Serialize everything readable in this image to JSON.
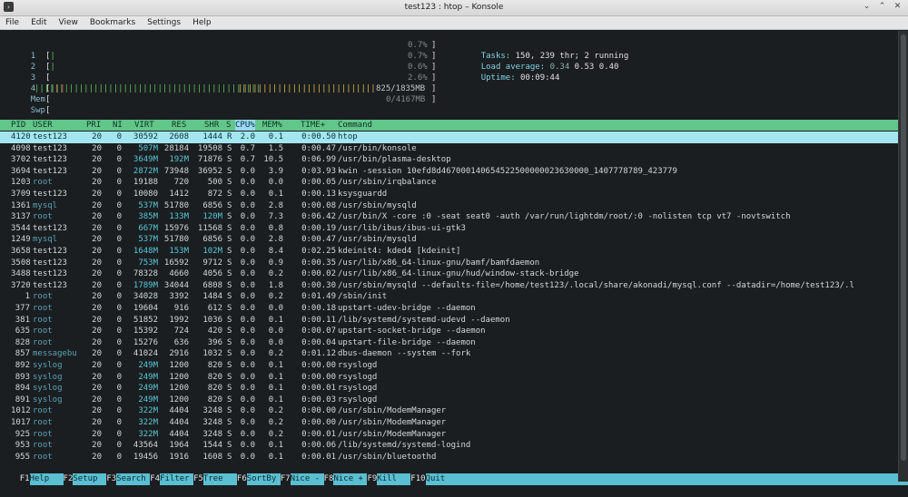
{
  "window": {
    "title": "test123 : htop – Konsole"
  },
  "menu": [
    "File",
    "Edit",
    "View",
    "Bookmarks",
    "Settings",
    "Help"
  ],
  "meters": {
    "cpus": [
      {
        "label": "1",
        "pct": "0.7%"
      },
      {
        "label": "2",
        "pct": "0.7%"
      },
      {
        "label": "3",
        "pct": "0.6%"
      },
      {
        "label": "4",
        "pct": "2.6%"
      }
    ],
    "mem": {
      "label": "Mem",
      "value": "825/1835MB"
    },
    "swp": {
      "label": "Swp",
      "value": "0/4167MB"
    }
  },
  "summary": {
    "tasks_label": "Tasks:",
    "tasks_value": "150, 239 thr; 2 running",
    "load_label": "Load average:",
    "load_1": "0.34",
    "load_5": "0.53",
    "load_15": "0.40",
    "uptime_label": "Uptime:",
    "uptime_value": "00:09:44"
  },
  "columns": [
    "PID",
    "USER",
    "PRI",
    "NI",
    "VIRT",
    "RES",
    "SHR",
    "S",
    "CPU%",
    "MEM%",
    "TIME+",
    "Command"
  ],
  "processes": [
    {
      "pid": "4120",
      "user": "test123",
      "pri": "20",
      "ni": "0",
      "virt": "30592",
      "res": "2608",
      "shr": "1444",
      "s": "R",
      "cpu": "2.0",
      "mem": "0.1",
      "time": "0:00.50",
      "cmd": "htop"
    },
    {
      "pid": "4098",
      "user": "test123",
      "pri": "20",
      "ni": "0",
      "virt": "507M",
      "res": "28184",
      "shr": "19508",
      "s": "S",
      "cpu": "0.7",
      "mem": "1.5",
      "time": "0:00.47",
      "cmd": "/usr/bin/konsole"
    },
    {
      "pid": "3702",
      "user": "test123",
      "pri": "20",
      "ni": "0",
      "virt": "3649M",
      "res": "192M",
      "shr": "71876",
      "s": "S",
      "cpu": "0.7",
      "mem": "10.5",
      "time": "0:06.99",
      "cmd": "/usr/bin/plasma-desktop"
    },
    {
      "pid": "3694",
      "user": "test123",
      "pri": "20",
      "ni": "0",
      "virt": "2872M",
      "res": "73948",
      "shr": "36952",
      "s": "S",
      "cpu": "0.0",
      "mem": "3.9",
      "time": "0:03.93",
      "cmd": "kwin -session 10efd8d467000140654522500000023630000_1407778789_423779"
    },
    {
      "pid": "1203",
      "user": "root",
      "pri": "20",
      "ni": "0",
      "virt": "19188",
      "res": "720",
      "shr": "500",
      "s": "S",
      "cpu": "0.0",
      "mem": "0.0",
      "time": "0:00.05",
      "cmd": "/usr/sbin/irqbalance"
    },
    {
      "pid": "3709",
      "user": "test123",
      "pri": "20",
      "ni": "0",
      "virt": "10080",
      "res": "1412",
      "shr": "872",
      "s": "S",
      "cpu": "0.0",
      "mem": "0.1",
      "time": "0:00.13",
      "cmd": "ksysguardd"
    },
    {
      "pid": "1361",
      "user": "mysql",
      "pri": "20",
      "ni": "0",
      "virt": "537M",
      "res": "51780",
      "shr": "6856",
      "s": "S",
      "cpu": "0.0",
      "mem": "2.8",
      "time": "0:00.08",
      "cmd": "/usr/sbin/mysqld"
    },
    {
      "pid": "3137",
      "user": "root",
      "pri": "20",
      "ni": "0",
      "virt": "385M",
      "res": "133M",
      "shr": "120M",
      "s": "S",
      "cpu": "0.0",
      "mem": "7.3",
      "time": "0:06.42",
      "cmd": "/usr/bin/X -core :0 -seat seat0 -auth /var/run/lightdm/root/:0 -nolisten tcp vt7 -novtswitch"
    },
    {
      "pid": "3544",
      "user": "test123",
      "pri": "20",
      "ni": "0",
      "virt": "667M",
      "res": "15976",
      "shr": "11568",
      "s": "S",
      "cpu": "0.0",
      "mem": "0.8",
      "time": "0:00.19",
      "cmd": "/usr/lib/ibus/ibus-ui-gtk3"
    },
    {
      "pid": "1249",
      "user": "mysql",
      "pri": "20",
      "ni": "0",
      "virt": "537M",
      "res": "51780",
      "shr": "6856",
      "s": "S",
      "cpu": "0.0",
      "mem": "2.8",
      "time": "0:00.47",
      "cmd": "/usr/sbin/mysqld"
    },
    {
      "pid": "3658",
      "user": "test123",
      "pri": "20",
      "ni": "0",
      "virt": "1648M",
      "res": "153M",
      "shr": "102M",
      "s": "S",
      "cpu": "0.0",
      "mem": "8.4",
      "time": "0:02.25",
      "cmd": "kdeinit4: kded4 [kdeinit]"
    },
    {
      "pid": "3508",
      "user": "test123",
      "pri": "20",
      "ni": "0",
      "virt": "753M",
      "res": "16592",
      "shr": "9712",
      "s": "S",
      "cpu": "0.0",
      "mem": "0.9",
      "time": "0:00.35",
      "cmd": "/usr/lib/x86_64-linux-gnu/bamf/bamfdaemon"
    },
    {
      "pid": "3488",
      "user": "test123",
      "pri": "20",
      "ni": "0",
      "virt": "78328",
      "res": "4660",
      "shr": "4056",
      "s": "S",
      "cpu": "0.0",
      "mem": "0.2",
      "time": "0:00.02",
      "cmd": "/usr/lib/x86_64-linux-gnu/hud/window-stack-bridge"
    },
    {
      "pid": "3720",
      "user": "test123",
      "pri": "20",
      "ni": "0",
      "virt": "1789M",
      "res": "34044",
      "shr": "6808",
      "s": "S",
      "cpu": "0.0",
      "mem": "1.8",
      "time": "0:00.30",
      "cmd": "/usr/sbin/mysqld --defaults-file=/home/test123/.local/share/akonadi/mysql.conf --datadir=/home/test123/.l"
    },
    {
      "pid": "1",
      "user": "root",
      "pri": "20",
      "ni": "0",
      "virt": "34028",
      "res": "3392",
      "shr": "1484",
      "s": "S",
      "cpu": "0.0",
      "mem": "0.2",
      "time": "0:01.49",
      "cmd": "/sbin/init"
    },
    {
      "pid": "377",
      "user": "root",
      "pri": "20",
      "ni": "0",
      "virt": "19604",
      "res": "916",
      "shr": "612",
      "s": "S",
      "cpu": "0.0",
      "mem": "0.0",
      "time": "0:00.18",
      "cmd": "upstart-udev-bridge --daemon"
    },
    {
      "pid": "381",
      "user": "root",
      "pri": "20",
      "ni": "0",
      "virt": "51852",
      "res": "1992",
      "shr": "1036",
      "s": "S",
      "cpu": "0.0",
      "mem": "0.1",
      "time": "0:00.11",
      "cmd": "/lib/systemd/systemd-udevd --daemon"
    },
    {
      "pid": "635",
      "user": "root",
      "pri": "20",
      "ni": "0",
      "virt": "15392",
      "res": "724",
      "shr": "420",
      "s": "S",
      "cpu": "0.0",
      "mem": "0.0",
      "time": "0:00.07",
      "cmd": "upstart-socket-bridge --daemon"
    },
    {
      "pid": "828",
      "user": "root",
      "pri": "20",
      "ni": "0",
      "virt": "15276",
      "res": "636",
      "shr": "396",
      "s": "S",
      "cpu": "0.0",
      "mem": "0.0",
      "time": "0:00.04",
      "cmd": "upstart-file-bridge --daemon"
    },
    {
      "pid": "857",
      "user": "messagebu",
      "pri": "20",
      "ni": "0",
      "virt": "41024",
      "res": "2916",
      "shr": "1032",
      "s": "S",
      "cpu": "0.0",
      "mem": "0.2",
      "time": "0:01.12",
      "cmd": "dbus-daemon --system --fork"
    },
    {
      "pid": "892",
      "user": "syslog",
      "pri": "20",
      "ni": "0",
      "virt": "249M",
      "res": "1200",
      "shr": "820",
      "s": "S",
      "cpu": "0.0",
      "mem": "0.1",
      "time": "0:00.00",
      "cmd": "rsyslogd"
    },
    {
      "pid": "893",
      "user": "syslog",
      "pri": "20",
      "ni": "0",
      "virt": "249M",
      "res": "1200",
      "shr": "820",
      "s": "S",
      "cpu": "0.0",
      "mem": "0.1",
      "time": "0:00.00",
      "cmd": "rsyslogd"
    },
    {
      "pid": "894",
      "user": "syslog",
      "pri": "20",
      "ni": "0",
      "virt": "249M",
      "res": "1200",
      "shr": "820",
      "s": "S",
      "cpu": "0.0",
      "mem": "0.1",
      "time": "0:00.01",
      "cmd": "rsyslogd"
    },
    {
      "pid": "891",
      "user": "syslog",
      "pri": "20",
      "ni": "0",
      "virt": "249M",
      "res": "1200",
      "shr": "820",
      "s": "S",
      "cpu": "0.0",
      "mem": "0.1",
      "time": "0:00.03",
      "cmd": "rsyslogd"
    },
    {
      "pid": "1012",
      "user": "root",
      "pri": "20",
      "ni": "0",
      "virt": "322M",
      "res": "4404",
      "shr": "3248",
      "s": "S",
      "cpu": "0.0",
      "mem": "0.2",
      "time": "0:00.00",
      "cmd": "/usr/sbin/ModemManager"
    },
    {
      "pid": "1017",
      "user": "root",
      "pri": "20",
      "ni": "0",
      "virt": "322M",
      "res": "4404",
      "shr": "3248",
      "s": "S",
      "cpu": "0.0",
      "mem": "0.2",
      "time": "0:00.00",
      "cmd": "/usr/sbin/ModemManager"
    },
    {
      "pid": "925",
      "user": "root",
      "pri": "20",
      "ni": "0",
      "virt": "322M",
      "res": "4404",
      "shr": "3248",
      "s": "S",
      "cpu": "0.0",
      "mem": "0.2",
      "time": "0:00.01",
      "cmd": "/usr/sbin/ModemManager"
    },
    {
      "pid": "953",
      "user": "root",
      "pri": "20",
      "ni": "0",
      "virt": "43564",
      "res": "1964",
      "shr": "1544",
      "s": "S",
      "cpu": "0.0",
      "mem": "0.1",
      "time": "0:00.06",
      "cmd": "/lib/systemd/systemd-logind"
    },
    {
      "pid": "955",
      "user": "root",
      "pri": "20",
      "ni": "0",
      "virt": "19456",
      "res": "1916",
      "shr": "1608",
      "s": "S",
      "cpu": "0.0",
      "mem": "0.1",
      "time": "0:00.01",
      "cmd": "/usr/sbin/bluetoothd"
    }
  ],
  "footer": [
    {
      "key": "F1",
      "label": "Help"
    },
    {
      "key": "F2",
      "label": "Setup"
    },
    {
      "key": "F3",
      "label": "Search"
    },
    {
      "key": "F4",
      "label": "Filter"
    },
    {
      "key": "F5",
      "label": "Tree"
    },
    {
      "key": "F6",
      "label": "SortBy"
    },
    {
      "key": "F7",
      "label": "Nice -"
    },
    {
      "key": "F8",
      "label": "Nice +"
    },
    {
      "key": "F9",
      "label": "Kill"
    },
    {
      "key": "F10",
      "label": "Quit"
    }
  ],
  "colors": {
    "header_bg": "#62c68b",
    "selected_bg": "#a3e6ef",
    "footer_label_bg": "#59bfd1",
    "terminal_bg": "#1b1e20"
  }
}
